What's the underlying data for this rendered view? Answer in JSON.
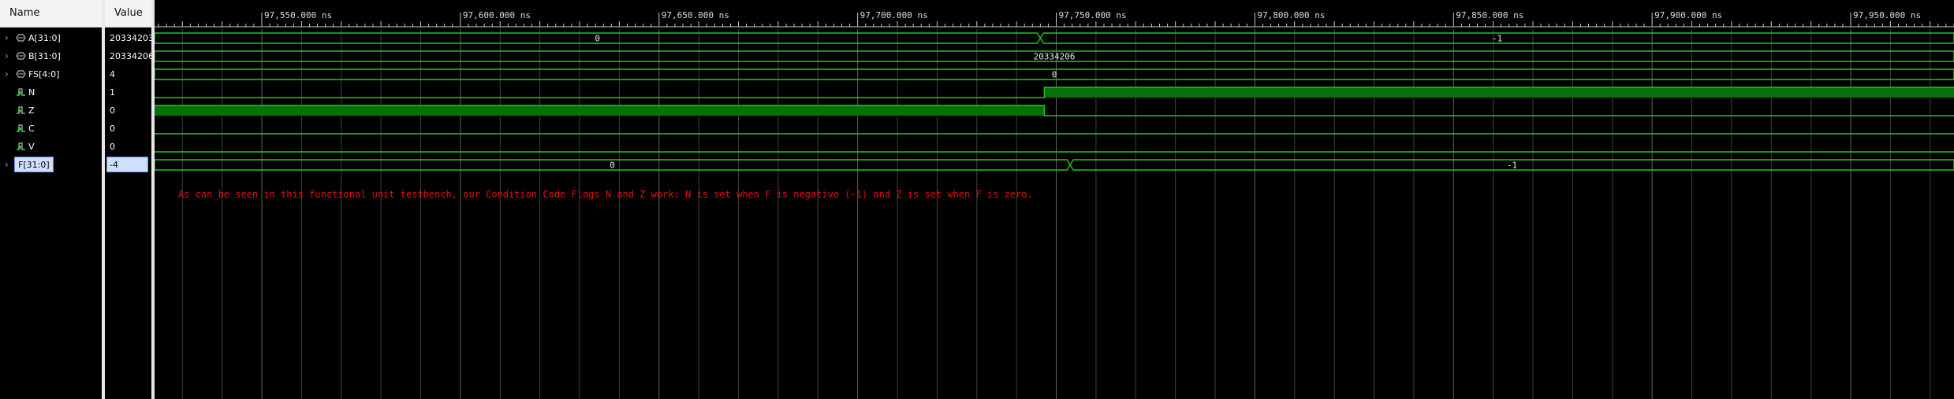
{
  "columns": {
    "name": "Name",
    "value": "Value"
  },
  "signals": [
    {
      "name": "A[31:0]",
      "value": "20334203",
      "kind": "bus",
      "selected": false
    },
    {
      "name": "B[31:0]",
      "value": "20334206",
      "kind": "bus",
      "selected": false
    },
    {
      "name": "FS[4:0]",
      "value": "4",
      "kind": "bus",
      "selected": false
    },
    {
      "name": "N",
      "value": "1",
      "kind": "bit",
      "selected": false
    },
    {
      "name": "Z",
      "value": "0",
      "kind": "bit",
      "selected": false
    },
    {
      "name": "C",
      "value": "0",
      "kind": "bit",
      "selected": false
    },
    {
      "name": "V",
      "value": "0",
      "kind": "bit",
      "selected": false
    },
    {
      "name": "F[31:0]",
      "value": "-4",
      "kind": "bus",
      "selected": true
    }
  ],
  "timeline": {
    "unit": "ns",
    "start_ns": 97523.0,
    "end_ns": 97976.0,
    "major_ticks": [
      "97,550.000 ns",
      "97,600.000 ns",
      "97,650.000 ns",
      "97,700.000 ns",
      "97,750.000 ns",
      "97,800.000 ns",
      "97,850.000 ns",
      "97,900.000 ns",
      "97,950.000 ns"
    ],
    "major_tick_values_ns": [
      97550,
      97600,
      97650,
      97700,
      97750,
      97800,
      97850,
      97900,
      97950
    ]
  },
  "waveforms": [
    {
      "signal": "A[31:0]",
      "type": "bus",
      "segments": [
        {
          "from": 97523.0,
          "to": 97746.0,
          "label": "0"
        },
        {
          "from": 97746.0,
          "to": 97976.0,
          "label": "-1"
        }
      ]
    },
    {
      "signal": "B[31:0]",
      "type": "bus",
      "segments": [
        {
          "from": 97523.0,
          "to": 97976.0,
          "label": "20334206"
        }
      ]
    },
    {
      "signal": "FS[4:0]",
      "type": "bus",
      "segments": [
        {
          "from": 97523.0,
          "to": 97976.0,
          "label": "0"
        }
      ]
    },
    {
      "signal": "N",
      "type": "bit",
      "segments": [
        {
          "from": 97523.0,
          "to": 97747.0,
          "level": 0
        },
        {
          "from": 97747.0,
          "to": 97976.0,
          "level": 1
        }
      ]
    },
    {
      "signal": "Z",
      "type": "bit",
      "segments": [
        {
          "from": 97523.0,
          "to": 97747.0,
          "level": 1
        },
        {
          "from": 97747.0,
          "to": 97976.0,
          "level": 0
        }
      ]
    },
    {
      "signal": "C",
      "type": "bit",
      "segments": [
        {
          "from": 97523.0,
          "to": 97976.0,
          "level": 0
        }
      ]
    },
    {
      "signal": "V",
      "type": "bit",
      "segments": [
        {
          "from": 97523.0,
          "to": 97976.0,
          "level": 0
        }
      ]
    },
    {
      "signal": "F[31:0]",
      "type": "bus",
      "segments": [
        {
          "from": 97523.0,
          "to": 97753.5,
          "label": "0"
        },
        {
          "from": 97753.5,
          "to": 97976.0,
          "label": "-1"
        }
      ]
    }
  ],
  "annotation": "As can be seen in this functional unit testbench, our Condition Code Flags N and Z work: N is set when F is negative (-1) and Z is set when F is zero.",
  "colors": {
    "waveform": "#1ec81e",
    "bit_fill": "#0a6e0a",
    "grid": "#606060",
    "annotation": "#e01010",
    "selection": "#cfe0ff"
  }
}
